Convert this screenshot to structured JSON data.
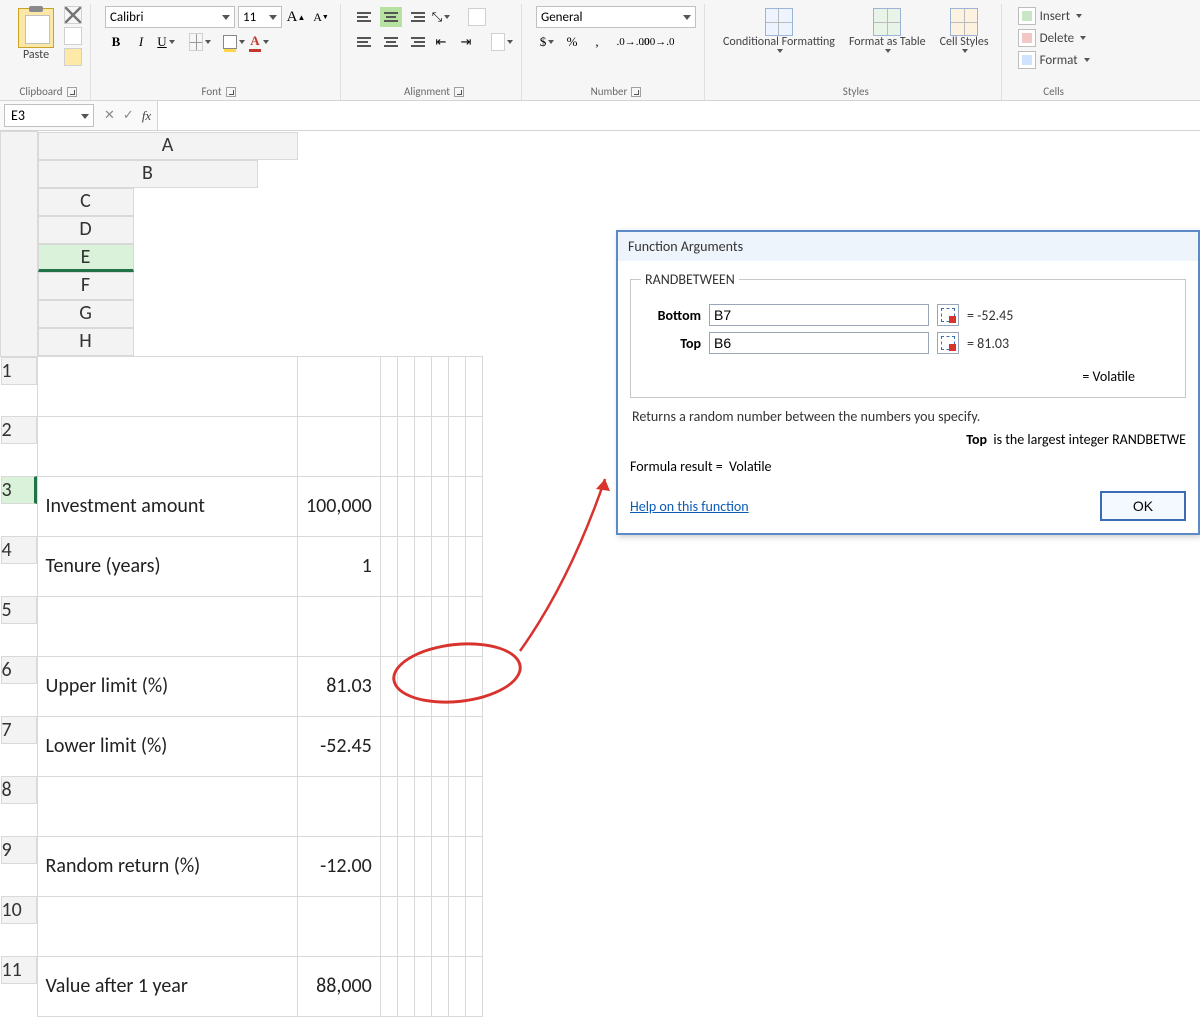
{
  "ribbon": {
    "clipboard": {
      "label": "Clipboard",
      "paste": "Paste"
    },
    "font": {
      "label": "Font",
      "name": "Calibri",
      "size": "11",
      "bold": "B",
      "italic": "I",
      "underline": "U"
    },
    "alignment": {
      "label": "Alignment"
    },
    "number": {
      "label": "Number",
      "format": "General",
      "currency": "$",
      "percent": "%",
      "comma": ","
    },
    "styles": {
      "label": "Styles",
      "cond": "Conditional Formatting",
      "fmt_as": "Format as Table",
      "cell": "Cell Styles"
    },
    "cells": {
      "label": "Cells",
      "insert": "Insert",
      "delete": "Delete",
      "format": "Format"
    }
  },
  "namebox": "E3",
  "columns": [
    "A",
    "B",
    "C",
    "D",
    "E",
    "F",
    "G",
    "H"
  ],
  "rows": [
    "1",
    "2",
    "3",
    "4",
    "5",
    "6",
    "7",
    "8",
    "9",
    "10",
    "11"
  ],
  "sheet": {
    "r3": {
      "a": "Investment amount",
      "b": "100,000"
    },
    "r4": {
      "a": "Tenure (years)",
      "b": "1"
    },
    "r6": {
      "a": "Upper limit (%)",
      "b": "81.03"
    },
    "r7": {
      "a": "Lower limit (%)",
      "b": "-52.45"
    },
    "r9": {
      "a": "Random return (%)",
      "b": "-12.00"
    },
    "r11": {
      "a": "Value after 1 year",
      "b": "88,000"
    }
  },
  "dialog": {
    "title": "Function Arguments",
    "func": "RANDBETWEEN",
    "bottom_label": "Bottom",
    "bottom_val": "B7",
    "bottom_res": "= -52.45",
    "top_label": "Top",
    "top_val": "B6",
    "top_res": "= 81.03",
    "volatile": "= Volatile",
    "desc": "Returns a random number between the numbers you specify.",
    "arg_name": "Top",
    "arg_help": "is the largest integer RANDBETWE",
    "formula_result_label": "Formula result =",
    "formula_result_val": "Volatile",
    "help": "Help on this function",
    "ok": "OK"
  }
}
